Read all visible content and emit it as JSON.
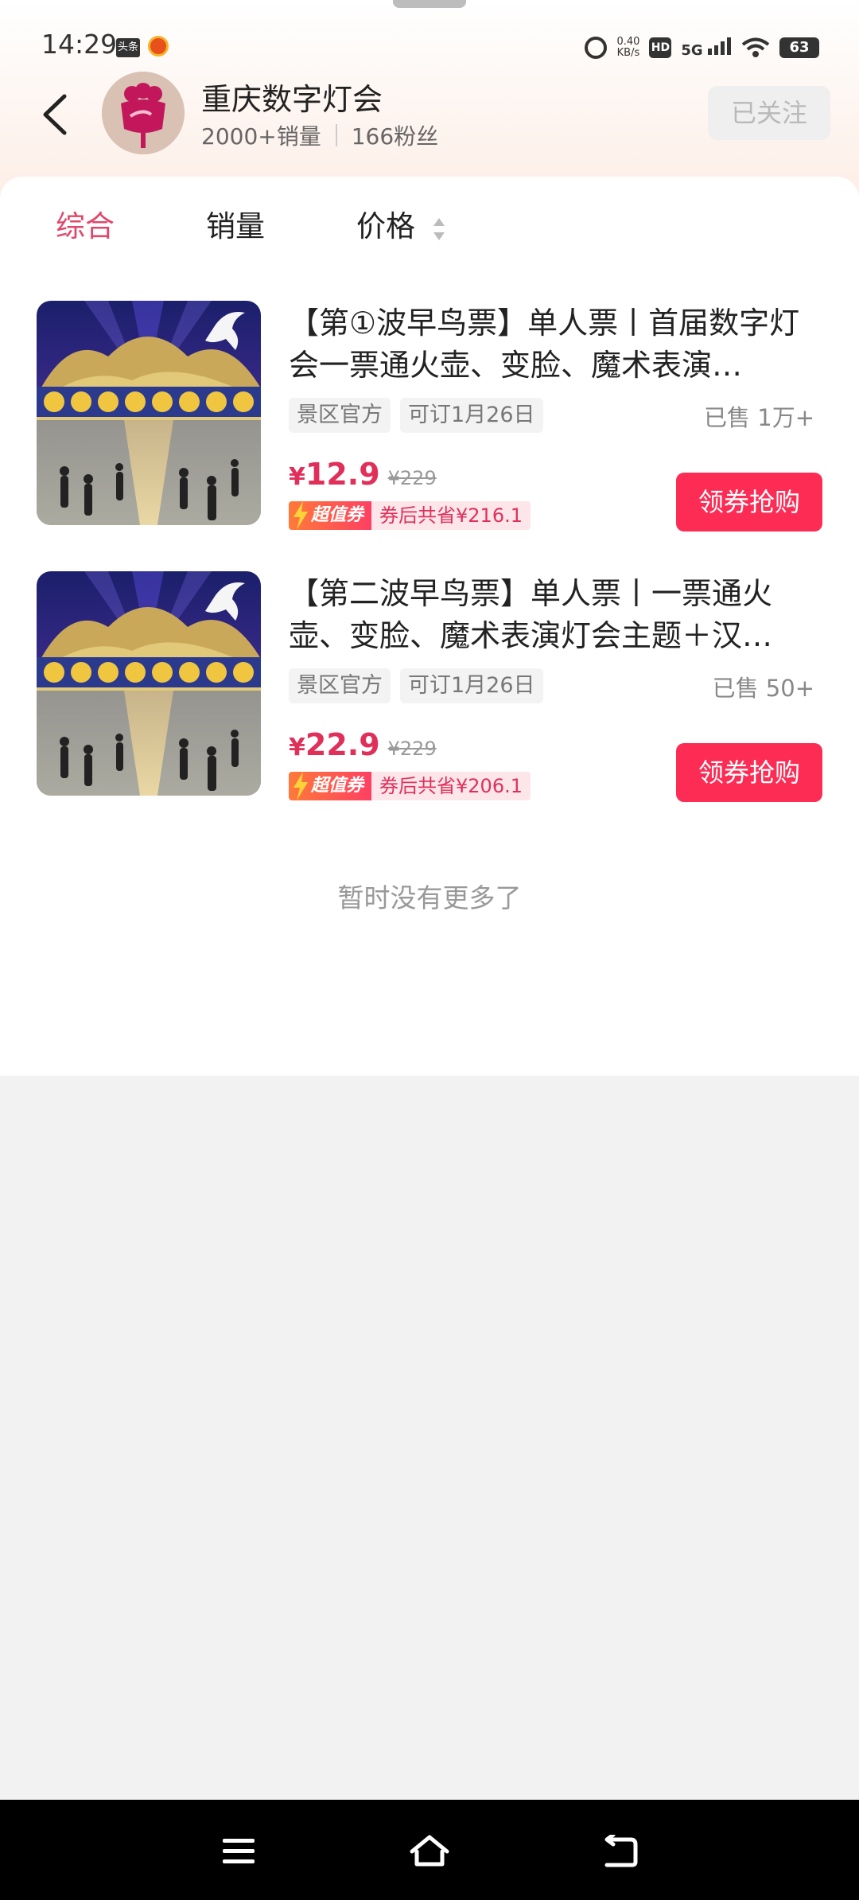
{
  "status_bar": {
    "time": "14:29",
    "news_badge": "头条",
    "net_speed_value": "0.40",
    "net_speed_unit": "KB/s",
    "hd": "HD",
    "network": "5G",
    "battery": "63"
  },
  "shop": {
    "name": "重庆数字灯会",
    "sales": "2000+销量",
    "fans": "166粉丝",
    "follow_label": "已关注"
  },
  "tabs": [
    {
      "label": "综合",
      "active": true
    },
    {
      "label": "销量",
      "active": false
    },
    {
      "label": "价格",
      "active": false
    }
  ],
  "products": [
    {
      "title": "【第①波早鸟票】单人票丨首届数字灯会一票通火壶、变脸、魔术表演…",
      "tags": [
        "景区官方",
        "可订1月26日"
      ],
      "sold": "已售 1万+",
      "currency": "¥",
      "price": "12.9",
      "original_price": "¥229",
      "coupon_badge": "超值券",
      "coupon_text": "券后共省¥216.1",
      "button": "领券抢购"
    },
    {
      "title": "【第二波早鸟票】单人票丨一票通火壶、变脸、魔术表演灯会主题＋汉…",
      "tags": [
        "景区官方",
        "可订1月26日"
      ],
      "sold": "已售 50+",
      "currency": "¥",
      "price": "22.9",
      "original_price": "¥229",
      "coupon_badge": "超值券",
      "coupon_text": "券后共省¥206.1",
      "button": "领券抢购"
    }
  ],
  "no_more": "暂时没有更多了",
  "icons": {
    "back": "back-arrow-icon",
    "sort": "sort-icon",
    "menu": "menu-icon",
    "home": "home-icon",
    "back_nav": "back-nav-icon"
  },
  "colors": {
    "accent_pink": "#e0486b",
    "buy_button": "#fd2c55",
    "price_red": "#e0305a"
  }
}
